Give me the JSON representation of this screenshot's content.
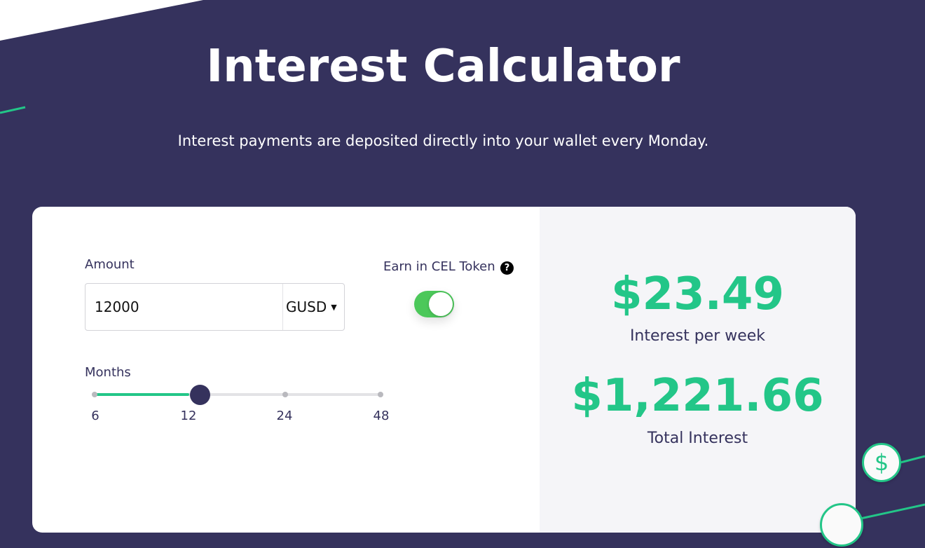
{
  "header": {
    "title": "Interest Calculator",
    "subtitle": "Interest payments are deposited directly into your wallet every Monday."
  },
  "form": {
    "amount_label": "Amount",
    "amount_value": "12000",
    "currency": "GUSD",
    "cel_label": "Earn in CEL Token",
    "help_glyph": "?",
    "cel_toggle_on": true,
    "months_label": "Months",
    "months_options": [
      "6",
      "12",
      "24",
      "48"
    ],
    "months_selected": "12"
  },
  "results": {
    "weekly_value": "$23.49",
    "weekly_label": "Interest per week",
    "total_value": "$1,221.66",
    "total_label": "Total Interest"
  },
  "decor": {
    "coin_glyph": "$"
  },
  "colors": {
    "background": "#35325d",
    "accent": "#23c688",
    "toggle": "#4cc85a",
    "panel": "#f5f5f8"
  }
}
